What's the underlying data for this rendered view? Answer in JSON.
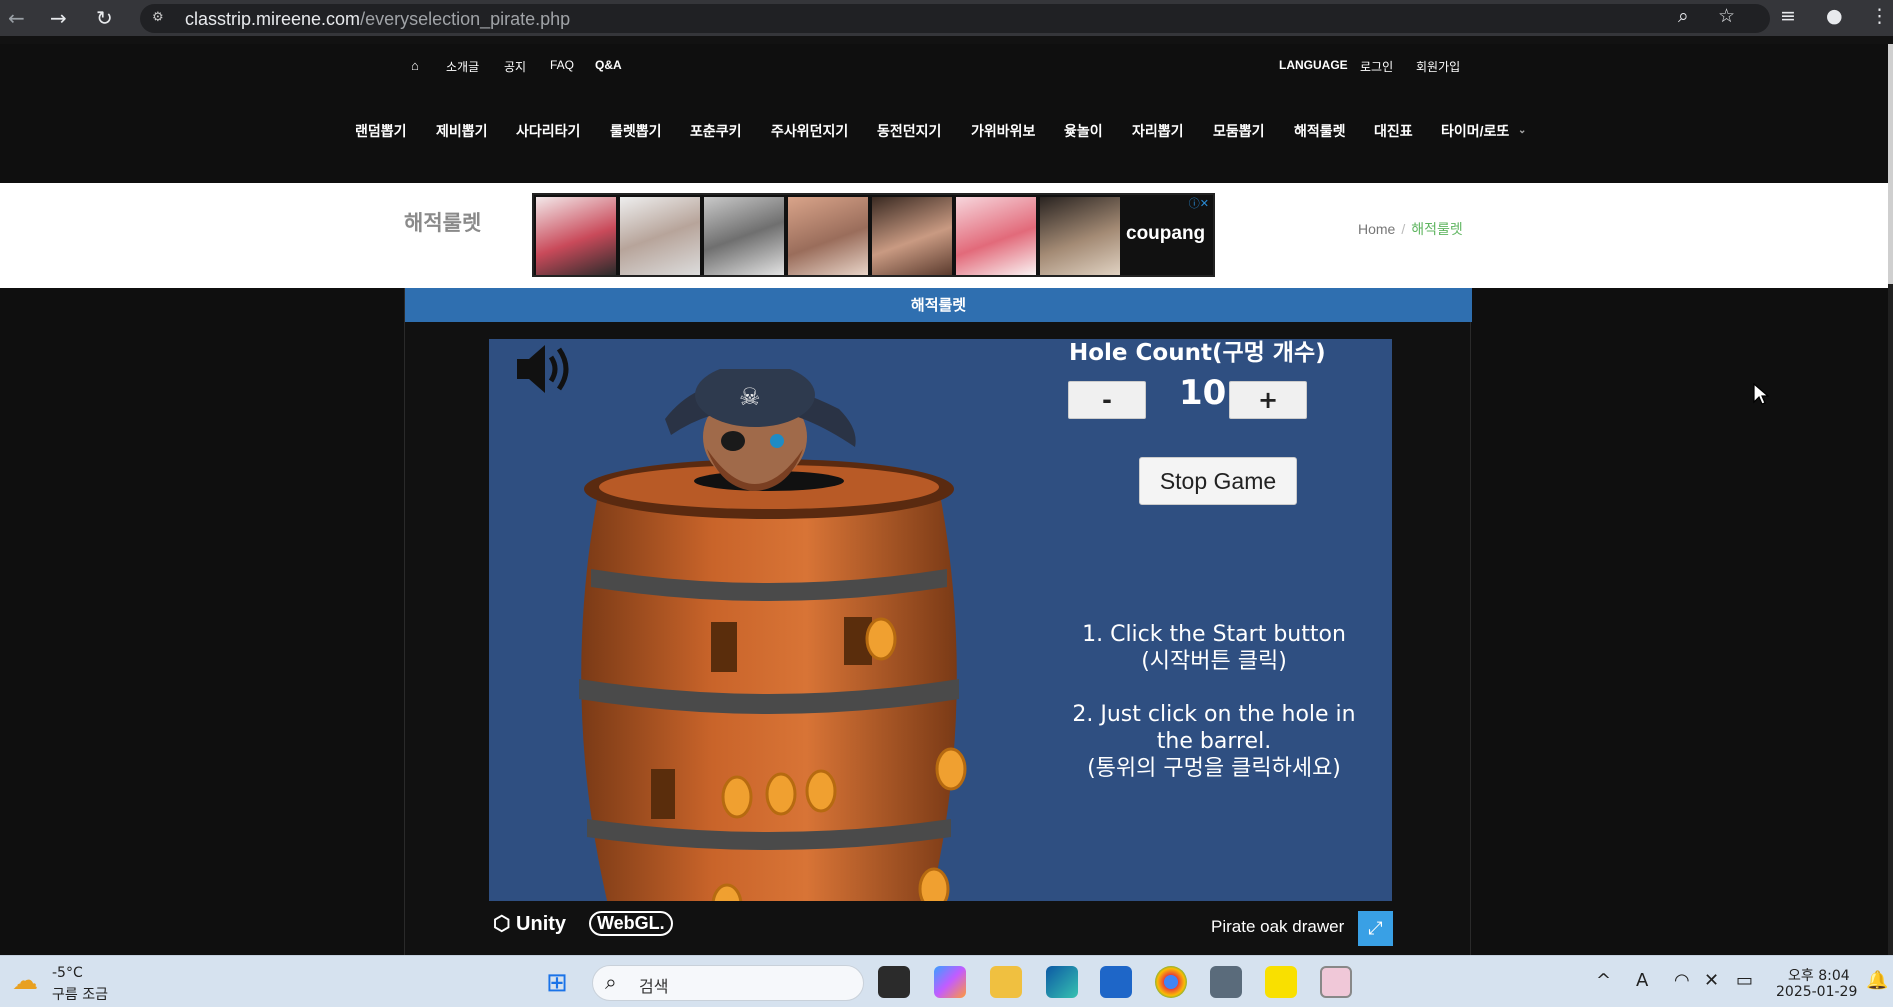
{
  "browser": {
    "url_host": "classtrip.mireene.com",
    "url_path": "/everyselection_pirate.php"
  },
  "top_menu": {
    "home_icon": "home-icon",
    "items": [
      "소개글",
      "공지",
      "FAQ",
      "Q&A"
    ],
    "right_items": [
      "LANGUAGE",
      "로그인",
      "회원가입"
    ]
  },
  "main_menu": {
    "items": [
      "랜덤뽑기",
      "제비뽑기",
      "사다리타기",
      "룰렛뽑기",
      "포춘쿠키",
      "주사위던지기",
      "동전던지기",
      "가위바위보",
      "윷놀이",
      "자리뽑기",
      "모둠뽑기",
      "해적룰렛",
      "대진표",
      "타이머/로또"
    ]
  },
  "header_band": {
    "page_title": "해적룰렛",
    "ad_brand": "coupang",
    "breadcrumb_home": "Home",
    "breadcrumb_sep": "/",
    "breadcrumb_current": "해적룰렛"
  },
  "content": {
    "box_title": "해적룰렛"
  },
  "game": {
    "hole_count_title": "Hole Count(구멍 개수)",
    "minus_label": "-",
    "plus_label": "+",
    "hole_count": "10",
    "stop_label": "Stop Game",
    "instruction_1a": "1. Click the Start button",
    "instruction_1b": "(시작버튼 클릭)",
    "instruction_2a": "2. Just click on the hole in",
    "instruction_2b": "the barrel.",
    "instruction_2c": "(통위의 구멍을 클릭하세요)"
  },
  "unity_footer": {
    "unity_label": "Unity",
    "webgl_label": "WebGL.",
    "product_name": "Pirate oak drawer"
  },
  "taskbar": {
    "weather_temp": "-5°C",
    "weather_desc": "구름 조금",
    "search_label": "검색",
    "time": "오후 8:04",
    "date": "2025-01-29"
  },
  "colors": {
    "header_blue": "#2f6fb0",
    "game_bg": "#2f4f81",
    "breadcrumb_current": "#5fb560",
    "fullscreen_btn": "#39a0e5"
  }
}
